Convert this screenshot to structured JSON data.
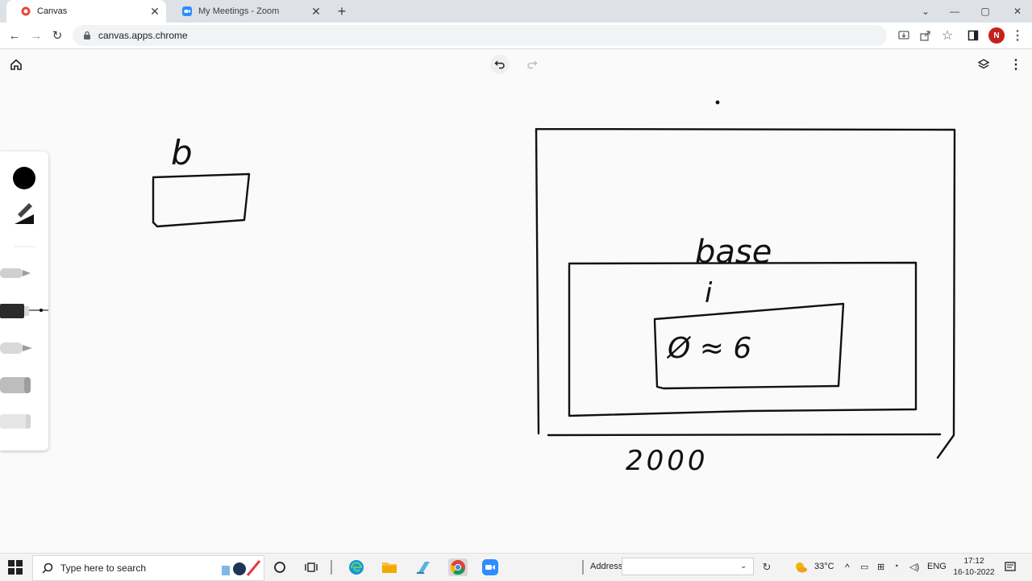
{
  "browser": {
    "tabs": [
      {
        "title": "Canvas",
        "active": true,
        "icon": "canvas-favicon"
      },
      {
        "title": "My Meetings - Zoom",
        "active": false,
        "icon": "zoom-favicon"
      }
    ],
    "url": "canvas.apps.chrome",
    "profile_initial": "N",
    "colors": {
      "tab_strip": "#dee1e6",
      "profile": "#c5221f"
    }
  },
  "canvas": {
    "drawing_labels": {
      "b": "b",
      "base": "base",
      "i": "i",
      "expression": "Ø ≈ 6",
      "amount": "2000"
    },
    "pen_palette": {
      "icons": [
        "ink-color-dot-icon",
        "pen-size-icon",
        "pen-tool-icon",
        "marker-tool-icon",
        "highlighter-tool-icon",
        "chalk-tool-icon",
        "eraser-tool-icon"
      ]
    }
  },
  "taskbar": {
    "search_placeholder": "Type here to search",
    "address_label": "Address",
    "address_value": "",
    "weather": "33°C",
    "language": "ENG",
    "time": "17:12",
    "date": "16-10-2022"
  }
}
